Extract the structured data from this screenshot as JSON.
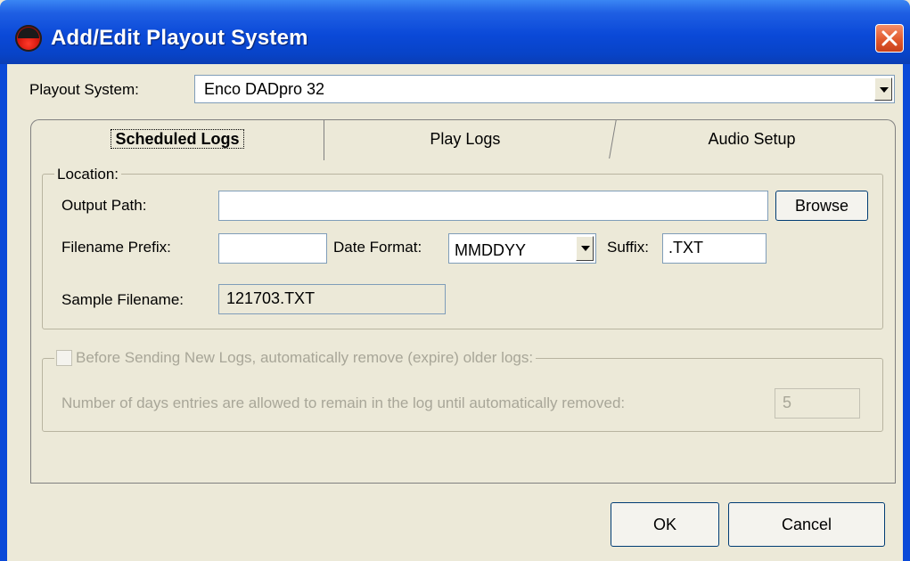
{
  "window": {
    "title": "Add/Edit Playout System"
  },
  "playout": {
    "label": "Playout System:",
    "value": "Enco DADpro 32"
  },
  "tabs": [
    {
      "label": "Scheduled Logs",
      "active": true
    },
    {
      "label": "Play Logs",
      "active": false
    },
    {
      "label": "Audio Setup",
      "active": false
    }
  ],
  "location": {
    "legend": "Location:",
    "output_path_label": "Output Path:",
    "output_path_value": "",
    "browse_label": "Browse",
    "prefix_label": "Filename Prefix:",
    "prefix_value": "",
    "date_format_label": "Date Format:",
    "date_format_value": "MMDDYY",
    "suffix_label": "Suffix:",
    "suffix_value": ".TXT",
    "sample_label": "Sample Filename:",
    "sample_value": "121703.TXT"
  },
  "expire": {
    "checkbox_label": "Before Sending New Logs, automatically remove (expire) older logs:",
    "checked": false,
    "days_label": "Number of days entries are allowed to remain in the log until automatically removed:",
    "days_value": "5"
  },
  "buttons": {
    "ok": "OK",
    "cancel": "Cancel"
  },
  "colors": {
    "titlebar": "#0A49D8",
    "close": "#E15A2E",
    "face": "#ECE9D8"
  }
}
